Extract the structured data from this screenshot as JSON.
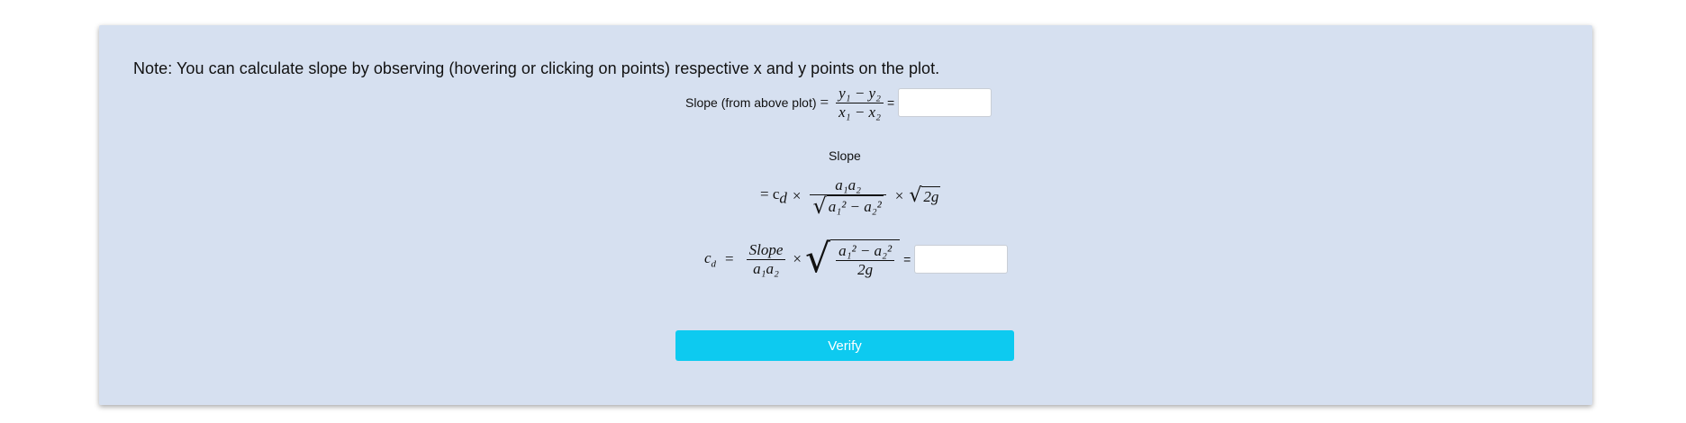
{
  "note": "Note: You can calculate slope by observing (hovering or clicking on points) respective x and y points on the plot.",
  "slope_row": {
    "label": "Slope (from above plot)",
    "equals": "=",
    "numerator": "y₁ − y₂",
    "denominator": "x₁ − x₂",
    "trailing_equals": "=",
    "input_value": ""
  },
  "slope_heading": "Slope",
  "slope_formula": {
    "lead": "= c",
    "lead_sub": "d",
    "times": "×",
    "numerator": "a₁a₂",
    "den_radicand": "a₁² − a₂²",
    "times2": "×",
    "sqrt_term": "2g"
  },
  "cd_row": {
    "lhs": "c",
    "lhs_sub": "d",
    "equals": "=",
    "frac_num": "Slope",
    "frac_den": "a₁a₂",
    "times": "×",
    "sqrt_num": "a₁² − a₂²",
    "sqrt_den": "2g",
    "trailing_equals": "=",
    "input_value": ""
  },
  "verify_label": "Verify",
  "colors": {
    "card_bg": "#d6e0f0",
    "button_bg": "#0dcaf0",
    "button_text": "#ffffff"
  }
}
